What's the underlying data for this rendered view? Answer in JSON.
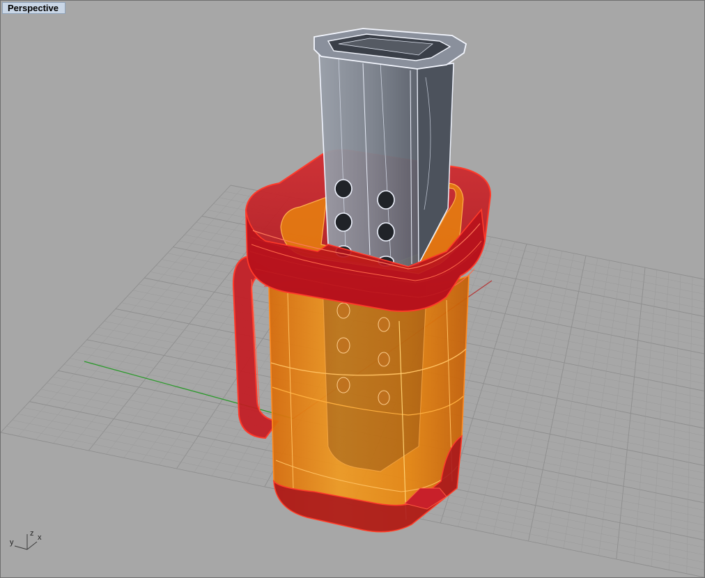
{
  "viewport": {
    "title": "Perspective",
    "axis_labels": {
      "x": "x",
      "y": "y",
      "z": "z"
    }
  },
  "colors": {
    "background": "#a7a7a7",
    "grid_minor": "#9a9a9a",
    "grid_major": "#8e8e8e",
    "x_axis": "#b43a3a",
    "y_axis": "#2c9a2c",
    "shell_orange": "#e8820e",
    "shell_red": "#b8121c",
    "outline_red": "#ff2a20",
    "basket_gray": "#6e7480",
    "basket_outline": "#f0f4ff"
  },
  "icons": {
    "axis_gizmo": "xyz-axes-icon"
  }
}
